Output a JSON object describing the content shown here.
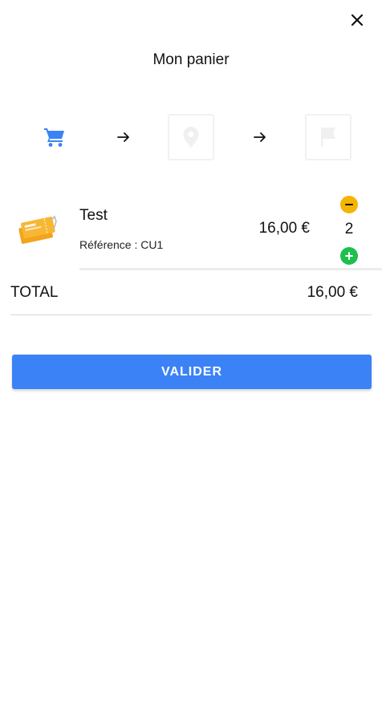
{
  "header": {
    "title": "Mon panier",
    "close_icon": "close-icon"
  },
  "steps": [
    {
      "icon": "cart-icon",
      "state": "active",
      "color": "#3b82f6"
    },
    {
      "icon": "location-pin-icon",
      "state": "inactive",
      "color": "#f0f0f0"
    },
    {
      "icon": "flag-icon",
      "state": "inactive",
      "color": "#f0f0f0"
    }
  ],
  "cart": {
    "items": [
      {
        "name": "Test",
        "reference": "Référence : CU1",
        "price": "16,00 €",
        "quantity": "2",
        "thumbnail_icon": "ticket-icon"
      }
    ],
    "total_label": "TOTAL",
    "total_value": "16,00 €"
  },
  "actions": {
    "validate_label": "VALIDER"
  },
  "colors": {
    "accent": "#3b82f6",
    "minus": "#f5b400",
    "plus": "#1dbf4e"
  }
}
